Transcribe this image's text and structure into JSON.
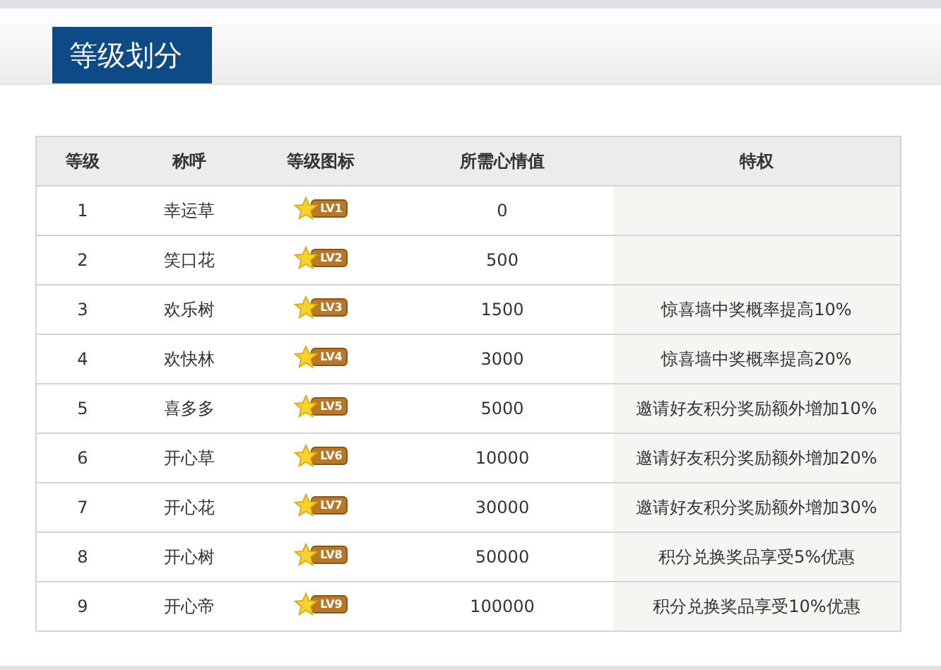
{
  "tab": {
    "title": "等级划分"
  },
  "table": {
    "columns": [
      "等级",
      "称呼",
      "等级图标",
      "所需心情值",
      "特权"
    ],
    "rows": [
      {
        "level": "1",
        "name": "幸运草",
        "badge": "LV1",
        "points": "0"
      },
      {
        "level": "2",
        "name": "笑口花",
        "badge": "LV2",
        "points": "500"
      },
      {
        "level": "3",
        "name": "欢乐树",
        "badge": "LV3",
        "points": "1500",
        "privilege": "惊喜墙中奖概率提高10%"
      },
      {
        "level": "4",
        "name": "欢快林",
        "badge": "LV4",
        "points": "3000",
        "privilege": "惊喜墙中奖概率提高20%"
      },
      {
        "level": "5",
        "name": "喜多多",
        "badge": "LV5",
        "points": "5000",
        "privilege": "邀请好友积分奖励额外增加10%"
      },
      {
        "level": "6",
        "name": "开心草",
        "badge": "LV6",
        "points": "10000",
        "privilege": "邀请好友积分奖励额外增加20%"
      },
      {
        "level": "7",
        "name": "开心花",
        "badge": "LV7",
        "points": "30000",
        "privilege": "邀请好友积分奖励额外增加30%"
      },
      {
        "level": "8",
        "name": "开心树",
        "badge": "LV8",
        "points": "50000",
        "privilege": "积分兑换奖品享受5%优惠"
      },
      {
        "level": "9",
        "name": "开心帝",
        "badge": "LV9",
        "points": "100000",
        "privilege": "积分兑换奖品享受10%优惠"
      }
    ]
  }
}
